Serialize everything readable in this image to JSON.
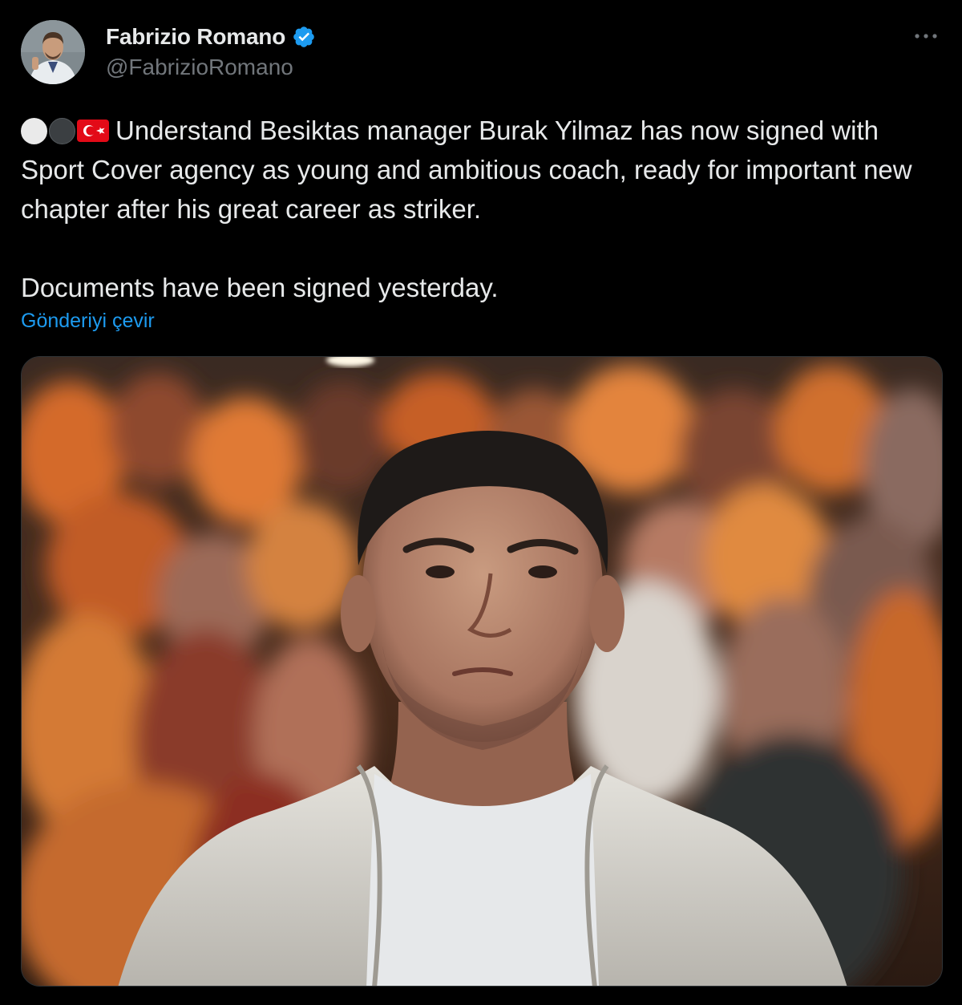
{
  "author": {
    "name": "Fabrizio Romano",
    "handle": "@FabrizioRomano",
    "verified": true,
    "avatar_icon": "avatar-photo"
  },
  "tweet": {
    "emojis": [
      "white-circle",
      "black-circle",
      "turkey-flag"
    ],
    "paragraph1": "Understand Besiktas manager Burak Yilmaz has now signed with Sport Cover agency as young and ambitious coach, ready for important new chapter after his great career as striker.",
    "paragraph2": "Documents have been signed yesterday.",
    "translate_label": "Gönderiyi çevir"
  },
  "media": {
    "type": "photo"
  },
  "colors": {
    "background": "#000000",
    "text": "#e7e9ea",
    "secondary_text": "#71767b",
    "link": "#1d9bf0",
    "verified_badge": "#1d9bf0"
  },
  "icons": {
    "more": "more-options-icon",
    "verified": "verified-badge-icon"
  }
}
